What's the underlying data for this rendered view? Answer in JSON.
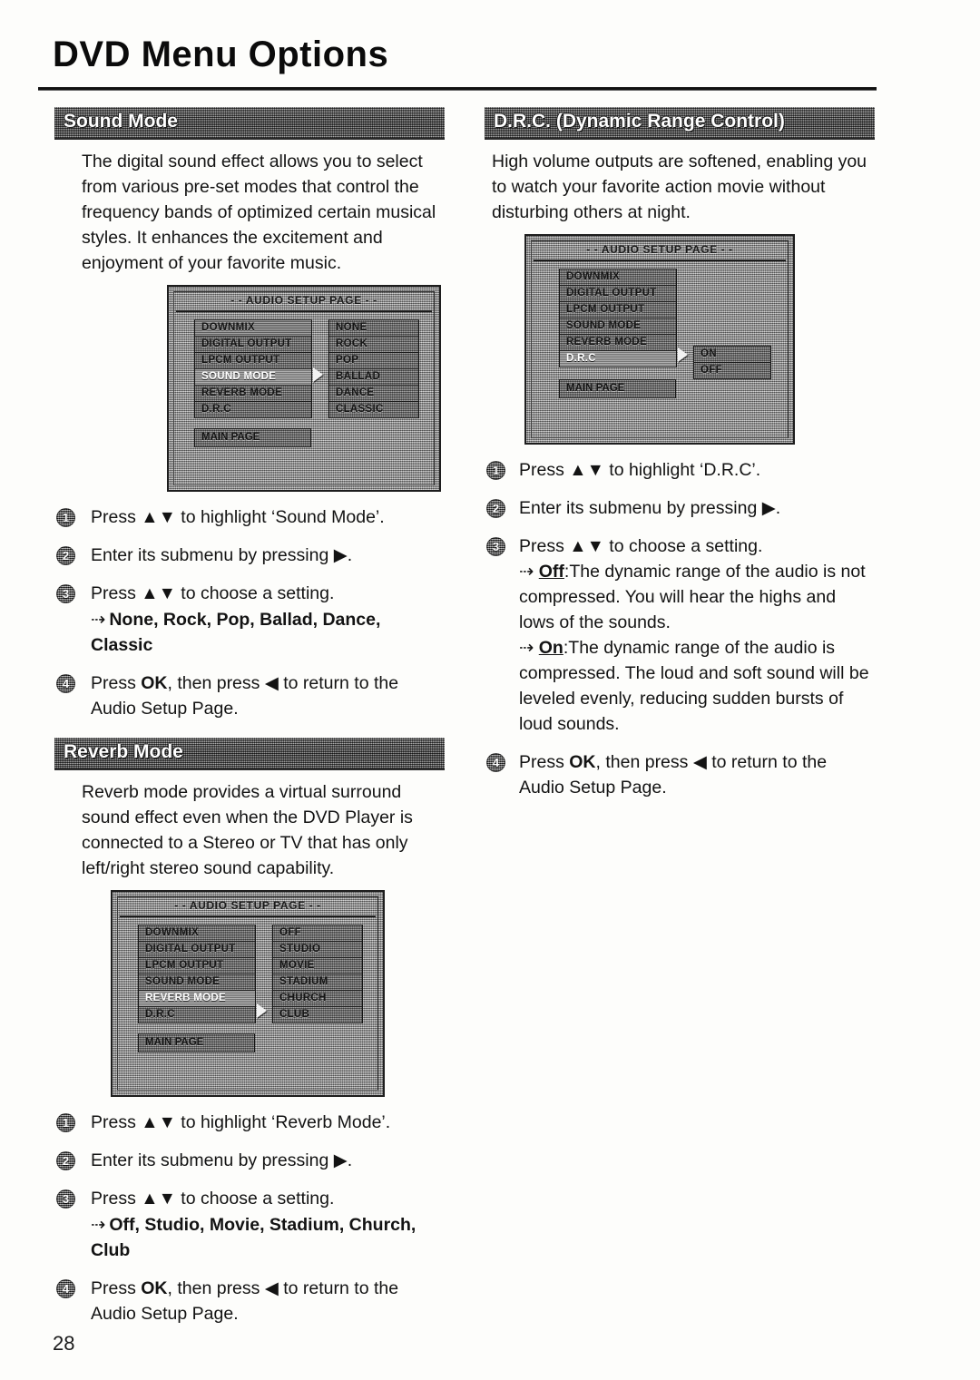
{
  "page": {
    "title": "DVD Menu Options",
    "number": "28"
  },
  "sections": {
    "sound_mode": {
      "header": "Sound Mode",
      "intro": "The digital sound effect allows you to select from various pre-set modes that control the frequency bands of optimized certain musical styles. It enhances the excitement and enjoyment of your favorite music.",
      "steps": [
        {
          "num": "1",
          "text": "Press ▲▼ to highlight ‘Sound Mode’."
        },
        {
          "num": "2",
          "text": "Enter its submenu by pressing ▶."
        },
        {
          "num": "3",
          "text": "Press ▲▼ to choose a setting.",
          "options_arrow": "⇢",
          "options": "None, Rock, Pop, Ballad, Dance, Classic"
        },
        {
          "num": "4",
          "text": "Press OK, then press ◀ to return to the Audio Setup Page.",
          "bold_word": "OK"
        }
      ]
    },
    "reverb_mode": {
      "header": "Reverb Mode",
      "intro": "Reverb mode provides a virtual surround sound effect even when the DVD Player is connected to a Stereo or TV that has only left/right stereo sound capability.",
      "steps": [
        {
          "num": "1",
          "text": "Press ▲▼ to highlight ‘Reverb Mode’."
        },
        {
          "num": "2",
          "text": "Enter its submenu by pressing ▶."
        },
        {
          "num": "3",
          "text": "Press ▲▼ to choose a setting.",
          "options_arrow": "⇢",
          "options": "Off, Studio, Movie, Stadium, Church, Club"
        },
        {
          "num": "4",
          "text": "Press OK, then press ◀ to return to the Audio Setup Page.",
          "bold_word": "OK"
        }
      ]
    },
    "drc": {
      "header": "D.R.C. (Dynamic Range Control)",
      "intro": "High volume outputs are softened, enabling you to watch your favorite action movie without disturbing others at night.",
      "steps": [
        {
          "num": "1",
          "text": "Press ▲▼ to highlight ‘D.R.C’."
        },
        {
          "num": "2",
          "text": "Enter its submenu by pressing ▶."
        },
        {
          "num": "3",
          "text": "Press ▲▼ to choose a setting."
        },
        {
          "num": "4",
          "text": "Press OK, then press ◀ to return to the Audio Setup Page."
        }
      ],
      "setting_off_label": "Off",
      "setting_off_text": ":The dynamic range of the audio is not compressed. You will hear the highs and lows of the sounds.",
      "setting_on_label": "On",
      "setting_on_text": ":The dynamic range of the audio is compressed. The loud and soft sound will be leveled evenly, reducing sudden bursts of loud sounds."
    }
  },
  "menus": {
    "sound_mode_screen": {
      "title": "- - AUDIO SETUP PAGE - -",
      "left_items": [
        {
          "label": "DOWNMIX",
          "selected": false
        },
        {
          "label": "DIGITAL OUTPUT",
          "selected": false
        },
        {
          "label": "LPCM OUTPUT",
          "selected": false
        },
        {
          "label": "SOUND MODE",
          "selected": true
        },
        {
          "label": "REVERB MODE",
          "selected": false
        },
        {
          "label": "D.R.C",
          "selected": false
        }
      ],
      "submenu_items": [
        {
          "label": "NONE"
        },
        {
          "label": "ROCK"
        },
        {
          "label": "POP"
        },
        {
          "label": "BALLAD"
        },
        {
          "label": "DANCE"
        },
        {
          "label": "CLASSIC"
        }
      ],
      "main_page_button": "MAIN PAGE"
    },
    "reverb_mode_screen": {
      "title": "- - AUDIO SETUP PAGE - -",
      "left_items": [
        {
          "label": "DOWNMIX",
          "selected": false
        },
        {
          "label": "DIGITAL OUTPUT",
          "selected": false
        },
        {
          "label": "LPCM OUTPUT",
          "selected": false
        },
        {
          "label": "SOUND MODE",
          "selected": false
        },
        {
          "label": "REVERB MODE",
          "selected": true
        },
        {
          "label": "D.R.C",
          "selected": false
        }
      ],
      "submenu_items": [
        {
          "label": "OFF"
        },
        {
          "label": "STUDIO"
        },
        {
          "label": "MOVIE"
        },
        {
          "label": "STADIUM"
        },
        {
          "label": "CHURCH"
        },
        {
          "label": "CLUB"
        }
      ],
      "main_page_button": "MAIN PAGE"
    },
    "drc_screen": {
      "title": "- - AUDIO SETUP PAGE - -",
      "left_items": [
        {
          "label": "DOWNMIX",
          "selected": false
        },
        {
          "label": "DIGITAL OUTPUT",
          "selected": false
        },
        {
          "label": "LPCM OUTPUT",
          "selected": false
        },
        {
          "label": "SOUND MODE",
          "selected": false
        },
        {
          "label": "REVERB MODE",
          "selected": false
        },
        {
          "label": "D.R.C",
          "selected": true
        }
      ],
      "submenu_items": [
        {
          "label": "ON"
        },
        {
          "label": "OFF"
        }
      ],
      "main_page_button": "MAIN PAGE"
    }
  }
}
